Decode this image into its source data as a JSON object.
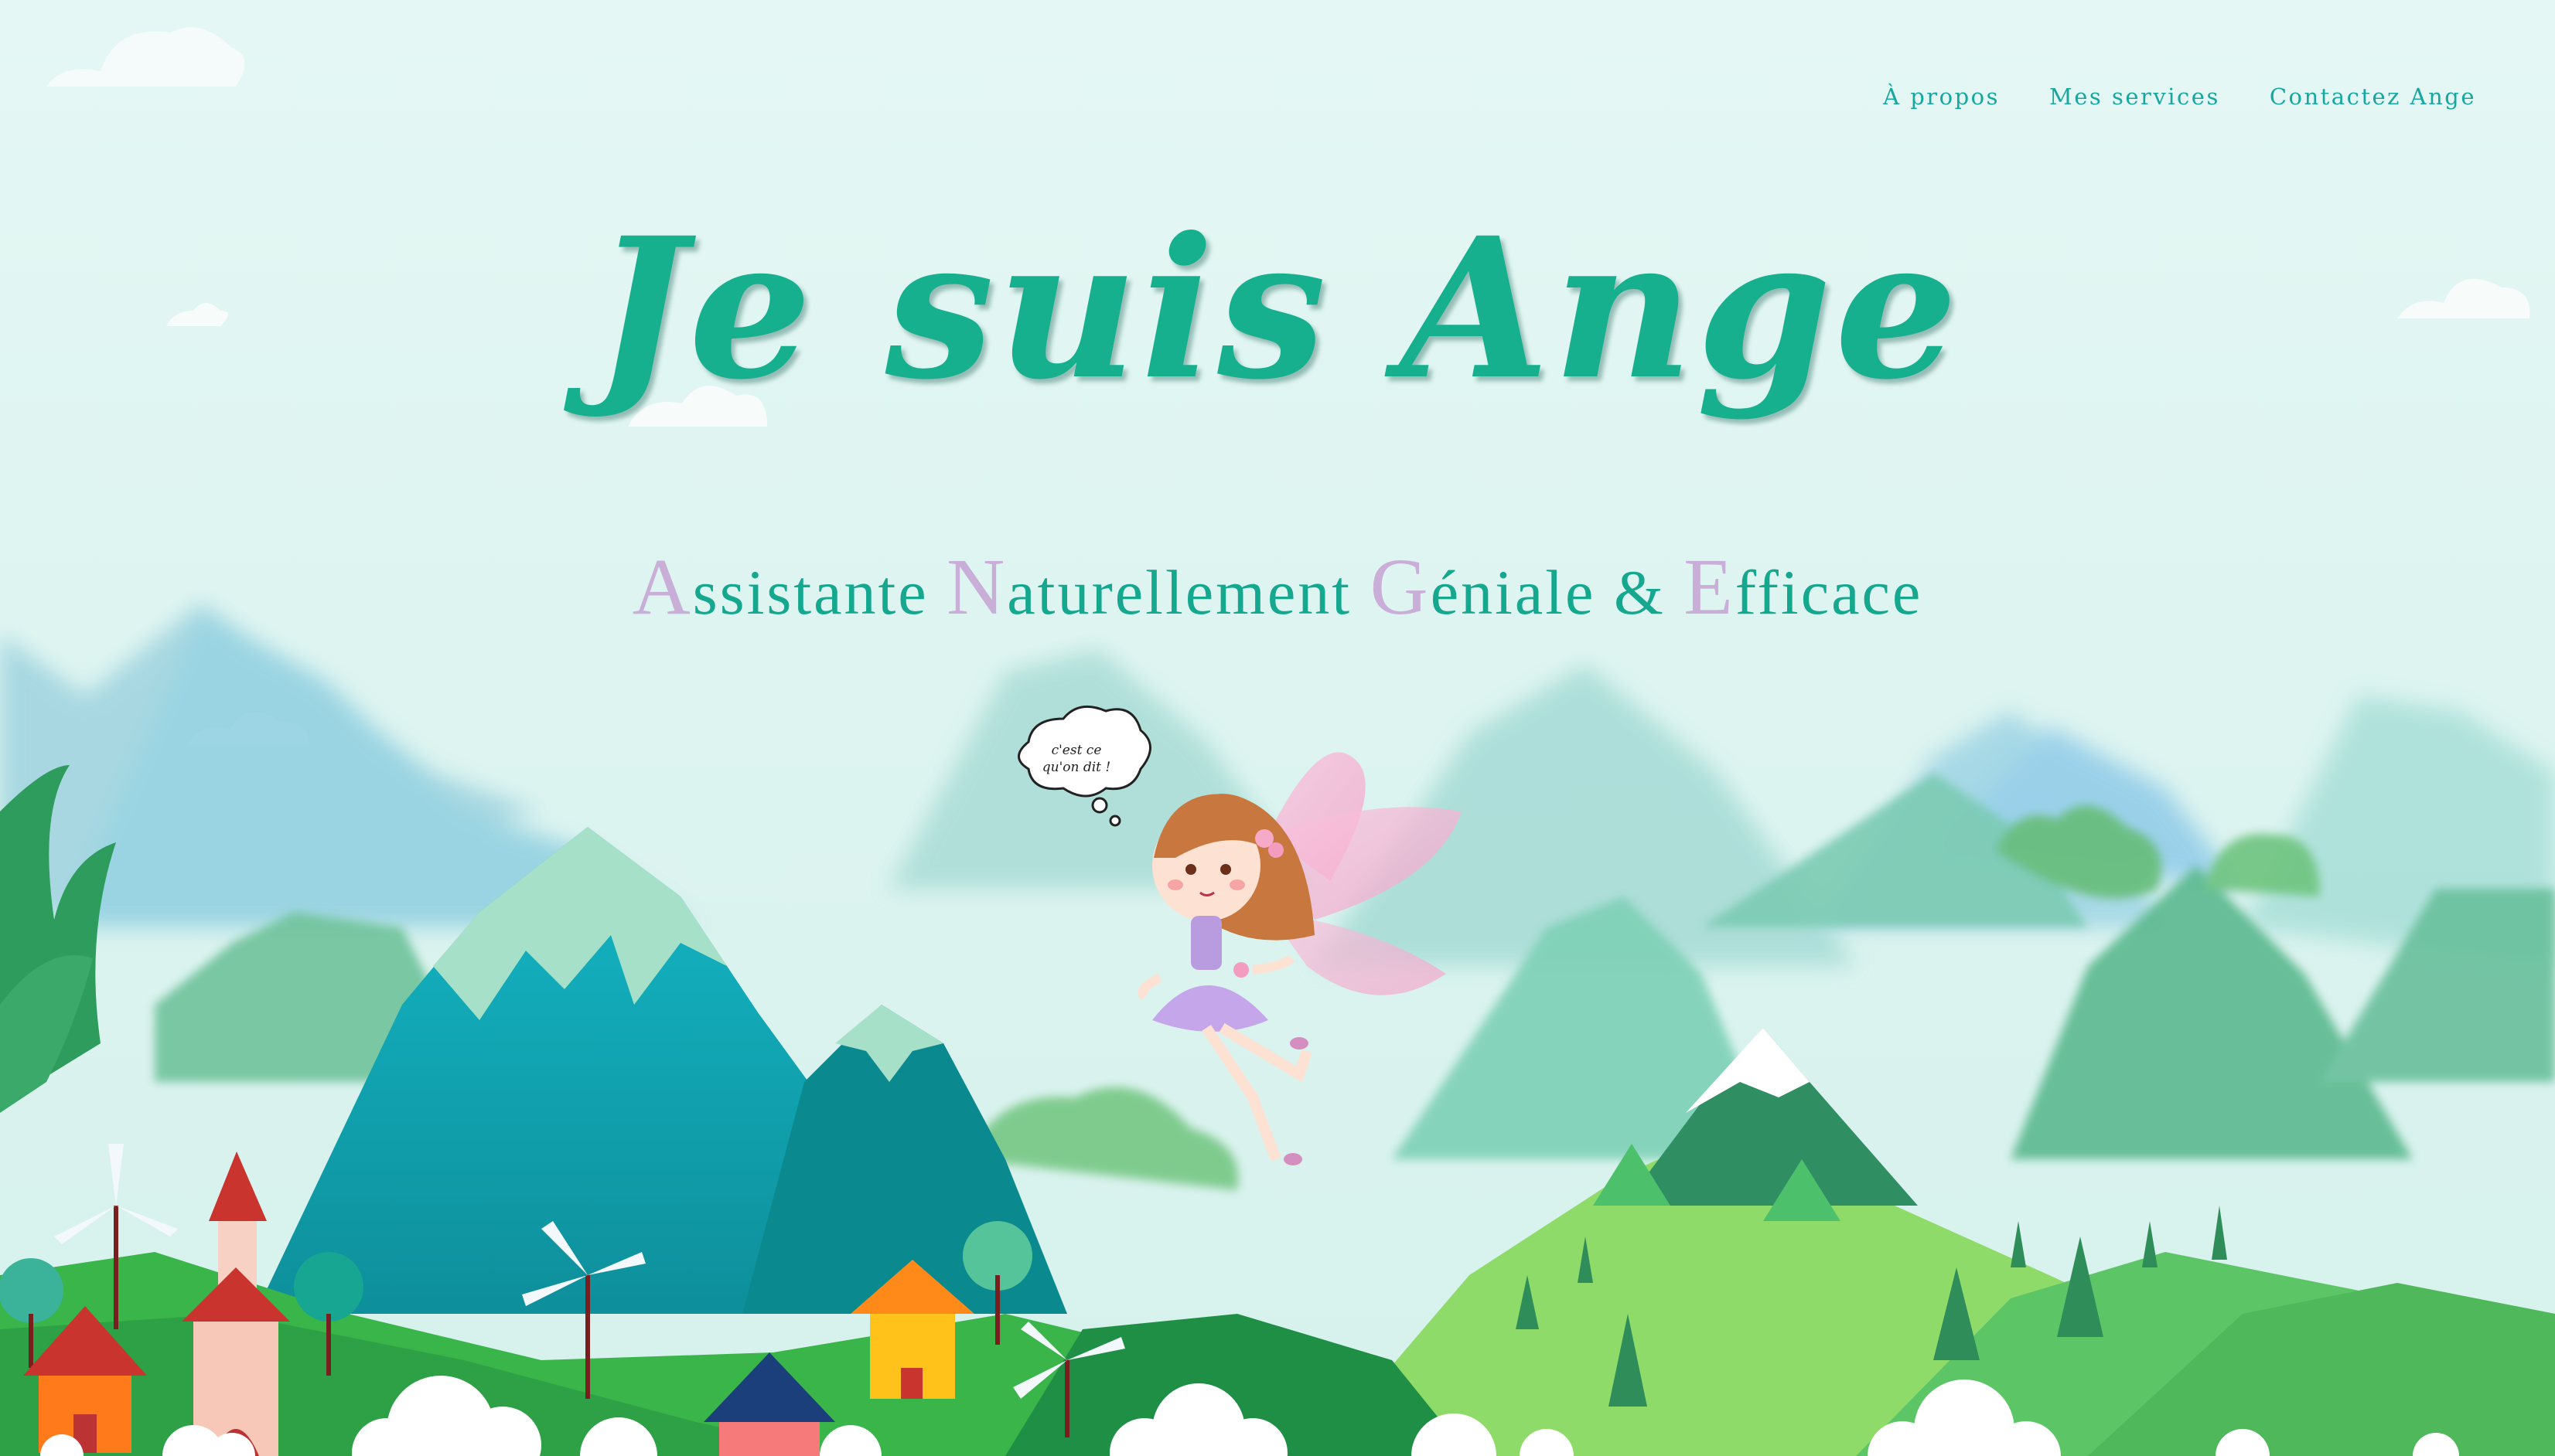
{
  "nav": {
    "items": [
      "À propos",
      "Mes services",
      "Contactez Ange"
    ]
  },
  "hero": {
    "title": "Je suis Ange",
    "subtitle": [
      {
        "initial": "A",
        "rest": "ssistante"
      },
      {
        "initial": "N",
        "rest": "aturellement"
      },
      {
        "initial": "G",
        "rest": "éniale"
      },
      {
        "initial": "",
        "rest": "&"
      },
      {
        "initial": "E",
        "rest": "fficace"
      }
    ]
  },
  "bubble": {
    "line1": "c'est ce",
    "line2": "qu'on dit !"
  },
  "colors": {
    "sky": "#e2f6f3",
    "title": "#16b08f",
    "subtitle": "#15a88f",
    "initials": "#c9aed7",
    "nav": "#17a6a0"
  }
}
